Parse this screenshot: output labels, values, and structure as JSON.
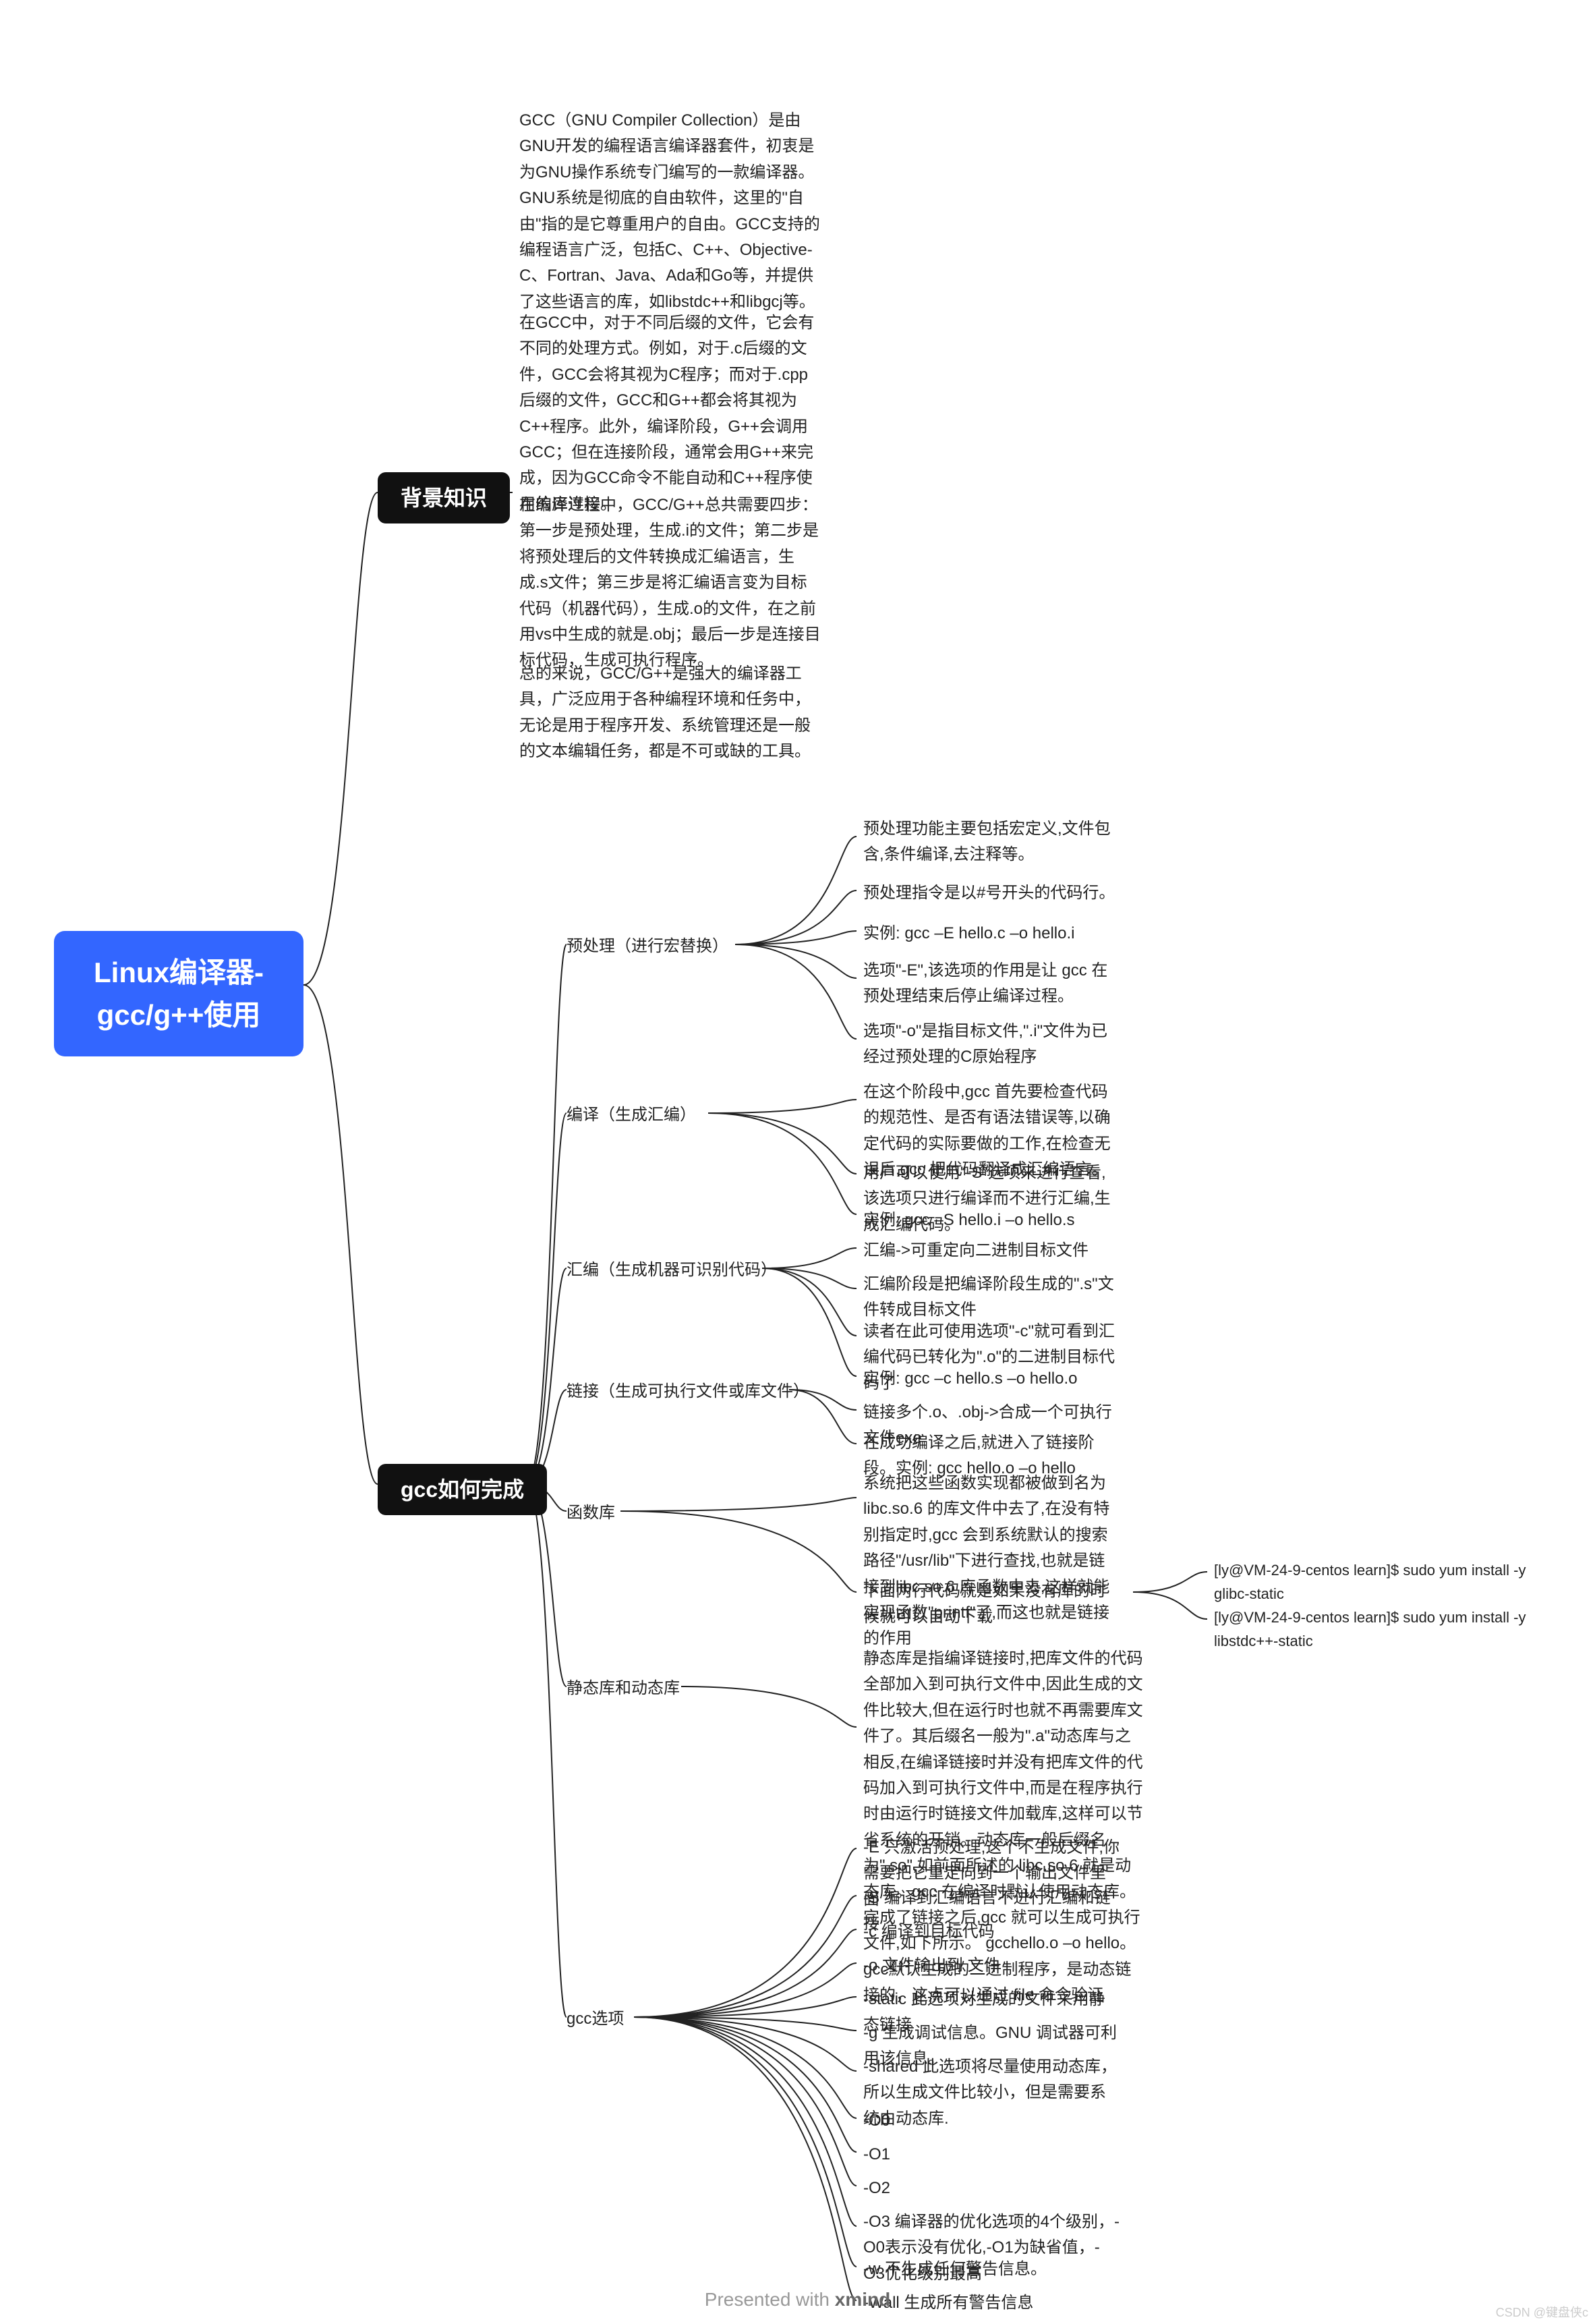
{
  "root": "Linux编译器-gcc/g++使用",
  "topic_bg": "背景知识",
  "topic_how": "gcc如何完成",
  "bg_p1": "GCC（GNU Compiler Collection）是由GNU开发的编程语言编译器套件，初衷是为GNU操作系统专门编写的一款编译器。GNU系统是彻底的自由软件，这里的\"自由\"指的是它尊重用户的自由。GCC支持的编程语言广泛，包括C、C++、Objective-C、Fortran、Java、Ada和Go等，并提供了这些语言的库，如libstdc++和libgcj等。",
  "bg_p2": "在GCC中，对于不同后缀的文件，它会有不同的处理方式。例如，对于.c后缀的文件，GCC会将其视为C程序；而对于.cpp后缀的文件，GCC和G++都会将其视为C++程序。此外，编译阶段，G++会调用GCC；但在连接阶段，通常会用G++来完成，因为GCC命令不能自动和C++程序使用的库连接。",
  "bg_p3": "在编译过程中，GCC/G++总共需要四步：第一步是预处理，生成.i的文件；第二步是将预处理后的文件转换成汇编语言，生成.s文件；第三步是将汇编语言变为目标代码（机器代码），生成.o的文件，在之前用vs中生成的就是.obj；最后一步是连接目标代码，生成可执行程序。",
  "bg_p4": "总的来说，GCC/G++是强大的编译器工具，广泛应用于各种编程环境和任务中，无论是用于程序开发、系统管理还是一般的文本编辑任务，都是不可或缺的工具。",
  "sub_pre": "预处理（进行宏替换）",
  "pre_p1": "预处理功能主要包括宏定义,文件包含,条件编译,去注释等。",
  "pre_p2": "预处理指令是以#号开头的代码行。",
  "pre_p3": "实例: gcc –E hello.c –o hello.i",
  "pre_p4": "选项\"-E\",该选项的作用是让 gcc 在预处理结束后停止编译过程。",
  "pre_p5": "选项\"-o\"是指目标文件,\".i\"文件为已经过预处理的C原始程序",
  "sub_compile": "编译（生成汇编）",
  "comp_p1": "在这个阶段中,gcc 首先要检查代码的规范性、是否有语法错误等,以确定代码的实际要做的工作,在检查无误后,gcc 把代码翻译成汇编语言。",
  "comp_p2": "用户可以使用\"-S\"选项来进行查看,该选项只进行编译而不进行汇编,生成汇编代码。",
  "comp_p3": "实例: gcc –S hello.i –o hello.s",
  "sub_asm": "汇编（生成机器可识别代码）",
  "asm_p1": "汇编->可重定向二进制目标文件",
  "asm_p2": "汇编阶段是把编译阶段生成的\".s\"文件转成目标文件",
  "asm_p3": "读者在此可使用选项\"-c\"就可看到汇编代码已转化为\".o\"的二进制目标代码了",
  "asm_p4": "实例: gcc –c hello.s –o hello.o",
  "sub_link": "链接（生成可执行文件或库文件）",
  "link_p1": "链接多个.o、.obj->合成一个可执行文件exe",
  "link_p2": "在成功编译之后,就进入了链接阶段。实例: gcc hello.o –o hello",
  "sub_lib": "函数库",
  "lib_p1": "系统把这些函数实现都被做到名为 libc.so.6 的库文件中去了,在没有特别指定时,gcc 会到系统默认的搜索路径\"/usr/lib\"下进行查找,也就是链接到libc.so.6 库函数中去,这样就能实现函数\"printf\"了,而这也就是链接的作用",
  "lib_p2": "下面两行代码就是如果没有库的时候就可以自动下载",
  "lib_cmd1": "[ly@VM-24-9-centos learn]$ sudo yum install -y glibc-static",
  "lib_cmd2": "[ly@VM-24-9-centos learn]$ sudo yum install -y libstdc++-static",
  "sub_static": "静态库和动态库",
  "static_p1": "静态库是指编译链接时,把库文件的代码全部加入到可执行文件中,因此生成的文件比较大,但在运行时也就不再需要库文件了。其后缀名一般为\".a\"动态库与之相反,在编译链接时并没有把库文件的代码加入到可执行文件中,而是在程序执行时由运行时链接文件加载库,这样可以节省系统的开销。动态库一般后缀名为\".so\",如前面所述的 libc.so.6 就是动态库。gcc 在编译时默认使用动态库。完成了链接之后,gcc 就可以生成可执行文件,如下所示。 gcchello.o –o hello。gcc默认生成的二进制程序，是动态链接的，这点可以通过 file 命令验证",
  "sub_opt": "gcc选项",
  "opt_1": "-E 只激活预处理,这个不生成文件,你需要把它重定向到一个输出文件里面",
  "opt_2": "-S 编译到汇编语言不进行汇编和链接",
  "opt_3": "-c 编译到目标代码",
  "opt_4": "-o 文件输出到 文件",
  "opt_5": "-static 此选项对生成的文件采用静态链接",
  "opt_6": "-g 生成调试信息。GNU 调试器可利用该信息。",
  "opt_7": "-shared 此选项将尽量使用动态库，所以生成文件比较小，但是需要系统由动态库.",
  "opt_8": "-O0",
  "opt_9": "-O1",
  "opt_10": "-O2",
  "opt_11": "-O3 编译器的优化选项的4个级别，-O0表示没有优化,-O1为缺省值，-O3优化级别最高",
  "opt_12": "-w 不生成任何警告信息。",
  "opt_13": "-Wall 生成所有警告信息",
  "footer_text": "Presented with ",
  "footer_brand": "xmind",
  "watermark": "CSDN @键盘侠c"
}
